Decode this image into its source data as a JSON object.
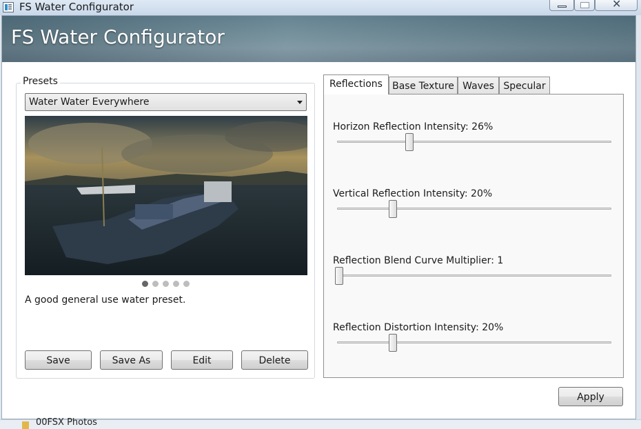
{
  "window": {
    "title": "FS Water Configurator",
    "icon": "app-window-icon",
    "controls": [
      "minimize-icon",
      "maximize-icon",
      "close-icon"
    ],
    "close_glyph": "✕"
  },
  "banner": {
    "title": "FS Water Configurator"
  },
  "presets": {
    "group_label": "Presets",
    "selected": "Water Water Everywhere",
    "description": "A good general use water preset.",
    "carousel": {
      "count": 5,
      "active_index": 0
    },
    "buttons": {
      "save": "Save",
      "save_as": "Save As",
      "edit": "Edit",
      "delete": "Delete"
    }
  },
  "tabs": [
    {
      "label": "Reflections",
      "active": true
    },
    {
      "label": "Base Texture",
      "active": false
    },
    {
      "label": "Waves",
      "active": false
    },
    {
      "label": "Specular",
      "active": false
    }
  ],
  "reflections": {
    "sliders": [
      {
        "label": "Horizon Reflection Intensity: 26%",
        "value_fraction": 0.26
      },
      {
        "label": "Vertical Reflection Intensity: 20%",
        "value_fraction": 0.2
      },
      {
        "label": "Reflection Blend Curve Multiplier: 1",
        "value_fraction": 0.0
      },
      {
        "label": "Reflection Distortion Intensity: 20%",
        "value_fraction": 0.2
      }
    ]
  },
  "apply_label": "Apply",
  "background_hint": {
    "text": "00FSX Photos",
    "icon": "folder-icon"
  },
  "colors": {
    "banner": "#6f8c98",
    "panel_bg": "#f9f9f9",
    "active_dot": "#666666"
  }
}
